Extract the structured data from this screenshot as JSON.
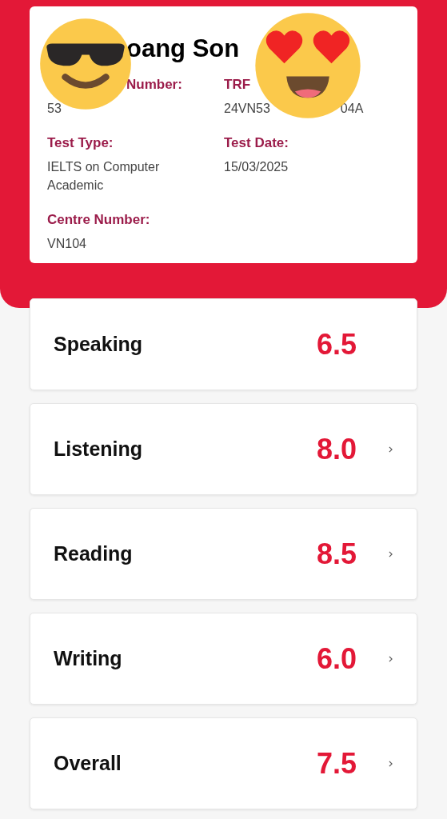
{
  "candidate": {
    "name": "oang Son",
    "fields": [
      {
        "label": "Number:",
        "value": [
          "53"
        ]
      },
      {
        "label": "TRF",
        "value": [
          "24VN53",
          "04A"
        ]
      },
      {
        "label": "Test Type:",
        "value": [
          "IELTS on Computer Academic"
        ]
      },
      {
        "label": "Test Date:",
        "value": [
          "15/03/2025"
        ]
      },
      {
        "label": "Centre Number:",
        "value": [
          "VN104"
        ]
      }
    ]
  },
  "scores": [
    {
      "skill": "Speaking",
      "band": "6.5",
      "chevron": false
    },
    {
      "skill": "Listening",
      "band": "8.0",
      "chevron": true
    },
    {
      "skill": "Reading",
      "band": "8.5",
      "chevron": true
    },
    {
      "skill": "Writing",
      "band": "6.0",
      "chevron": true
    },
    {
      "skill": "Overall",
      "band": "7.5",
      "chevron": true
    }
  ]
}
